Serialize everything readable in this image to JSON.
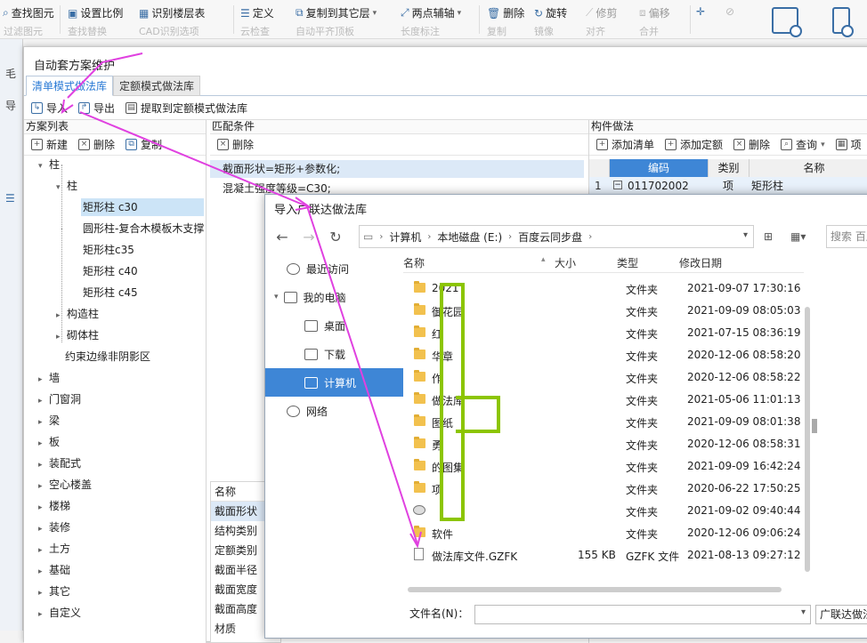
{
  "ribbon": {
    "items": [
      "查找图元",
      "设置比例",
      "识别楼层表",
      "定义",
      "复制到其它层",
      "两点辅轴",
      "删除",
      "旋转",
      "修剪",
      "偏移"
    ],
    "clipped": [
      "过滤图元",
      "查找替换",
      "CAD识别选项",
      "云检查",
      "自动平齐顶板",
      "长度标注",
      "复制",
      "镜像",
      "对齐",
      "合并"
    ],
    "icons": [
      "search-icon",
      "scale-icon",
      "floor-table-icon",
      "define-icon",
      "copy-layer-icon",
      "axis-icon",
      "delete-icon",
      "rotate-icon",
      "trim-icon",
      "offset-icon",
      "point-icon",
      "stop-icon"
    ]
  },
  "bg_left": [
    "毛",
    "导",
    "过"
  ],
  "dialog1": {
    "title": "自动套方案维护",
    "tabs": [
      "清单模式做法库",
      "定额模式做法库"
    ],
    "toolbar": {
      "import": "导入",
      "export": "导出",
      "extract": "提取到定额模式做法库"
    },
    "scheme_panel": {
      "title": "方案列表",
      "new": "新建",
      "delete": "删除",
      "copy": "复制",
      "tree": [
        {
          "label": "柱"
        },
        {
          "label": "柱"
        },
        {
          "label": "矩形柱 c30"
        },
        {
          "label": "圆形柱-复合木模板木支撑"
        },
        {
          "label": "矩形柱c35"
        },
        {
          "label": "矩形柱 c40"
        },
        {
          "label": "矩形柱 c45"
        },
        {
          "label": "构造柱"
        },
        {
          "label": "砌体柱"
        },
        {
          "label": "约束边缘非阴影区"
        },
        {
          "label": "墙"
        },
        {
          "label": "门窗洞"
        },
        {
          "label": "梁"
        },
        {
          "label": "板"
        },
        {
          "label": "装配式"
        },
        {
          "label": "空心楼盖"
        },
        {
          "label": "楼梯"
        },
        {
          "label": "装修"
        },
        {
          "label": "土方"
        },
        {
          "label": "基础"
        },
        {
          "label": "其它"
        },
        {
          "label": "自定义"
        }
      ]
    },
    "match_panel": {
      "title": "匹配条件",
      "delete": "删除",
      "conditions": [
        "截面形状=矩形+参数化;",
        "混凝土强度等级=C30;"
      ]
    },
    "comp_panel": {
      "title": "构件做法",
      "add_list": "添加清单",
      "add_quota": "添加定额",
      "delete": "删除",
      "query": "查询",
      "more": "项",
      "headers": [
        "编码",
        "类别",
        "名称"
      ],
      "row": {
        "index": "1",
        "code": "011702002",
        "kind": "项",
        "name": "矩形柱"
      }
    },
    "bottom_panel": {
      "header": "名称",
      "items": [
        "截面形状",
        "结构类别",
        "定额类别",
        "截面半径",
        "截面宽度",
        "截面高度",
        "材质"
      ]
    }
  },
  "dialog2": {
    "title": "导入广联达做法库",
    "path": [
      "计算机",
      "本地磁盘 (E:)",
      "百度云同步盘"
    ],
    "search_placeholder": "搜索 百度",
    "sidebar": [
      {
        "label": "最近访问"
      },
      {
        "label": "我的电脑"
      },
      {
        "label": "桌面"
      },
      {
        "label": "下载"
      },
      {
        "label": "计算机"
      },
      {
        "label": "网络"
      }
    ],
    "columns": [
      "名称",
      "大小",
      "类型",
      "修改日期"
    ],
    "files": [
      {
        "name": "2021",
        "size": "",
        "type": "文件夹",
        "date": "2021-09-07 17:30:16",
        "icon": "folder-icon"
      },
      {
        "name": "御花园",
        "size": "",
        "type": "文件夹",
        "date": "2021-09-09 08:05:03",
        "icon": "folder-icon"
      },
      {
        "name": "红",
        "size": "",
        "type": "文件夹",
        "date": "2021-07-15 08:36:19",
        "icon": "folder-icon"
      },
      {
        "name": "华章",
        "size": "",
        "type": "文件夹",
        "date": "2020-12-06 08:58:20",
        "icon": "folder-icon"
      },
      {
        "name": "作",
        "size": "",
        "type": "文件夹",
        "date": "2020-12-06 08:58:22",
        "icon": "folder-icon"
      },
      {
        "name": "做法库",
        "size": "",
        "type": "文件夹",
        "date": "2021-05-06 11:01:13",
        "icon": "folder-icon"
      },
      {
        "name": "图纸",
        "size": "",
        "type": "文件夹",
        "date": "2021-09-09 08:01:38",
        "icon": "folder-icon"
      },
      {
        "name": "勇",
        "size": "",
        "type": "文件夹",
        "date": "2020-12-06 08:58:31",
        "icon": "folder-icon"
      },
      {
        "name": "的图集",
        "size": "",
        "type": "文件夹",
        "date": "2021-09-09 16:42:24",
        "icon": "folder-icon"
      },
      {
        "name": "项",
        "size": "",
        "type": "文件夹",
        "date": "2020-06-22 17:50:25",
        "icon": "folder-icon"
      },
      {
        "name": "",
        "size": "",
        "type": "文件夹",
        "date": "2021-09-02 09:40:44",
        "icon": "drive-icon"
      },
      {
        "name": "软件",
        "size": "",
        "type": "文件夹",
        "date": "2020-12-06 09:06:24",
        "icon": "folder-icon"
      },
      {
        "name": "做法库文件.GZFK",
        "size": "155 KB",
        "type": "GZFK 文件",
        "date": "2021-08-13 09:27:12",
        "icon": "file-icon"
      }
    ],
    "filename_label": "文件名(N)：",
    "filename_value": "",
    "filetype": "广联达做法库"
  },
  "colors": {
    "accent": "#2a7ad5",
    "selection": "#3e86d6",
    "annotation_arrow": "#e041e0",
    "redaction": "#8cc500"
  }
}
